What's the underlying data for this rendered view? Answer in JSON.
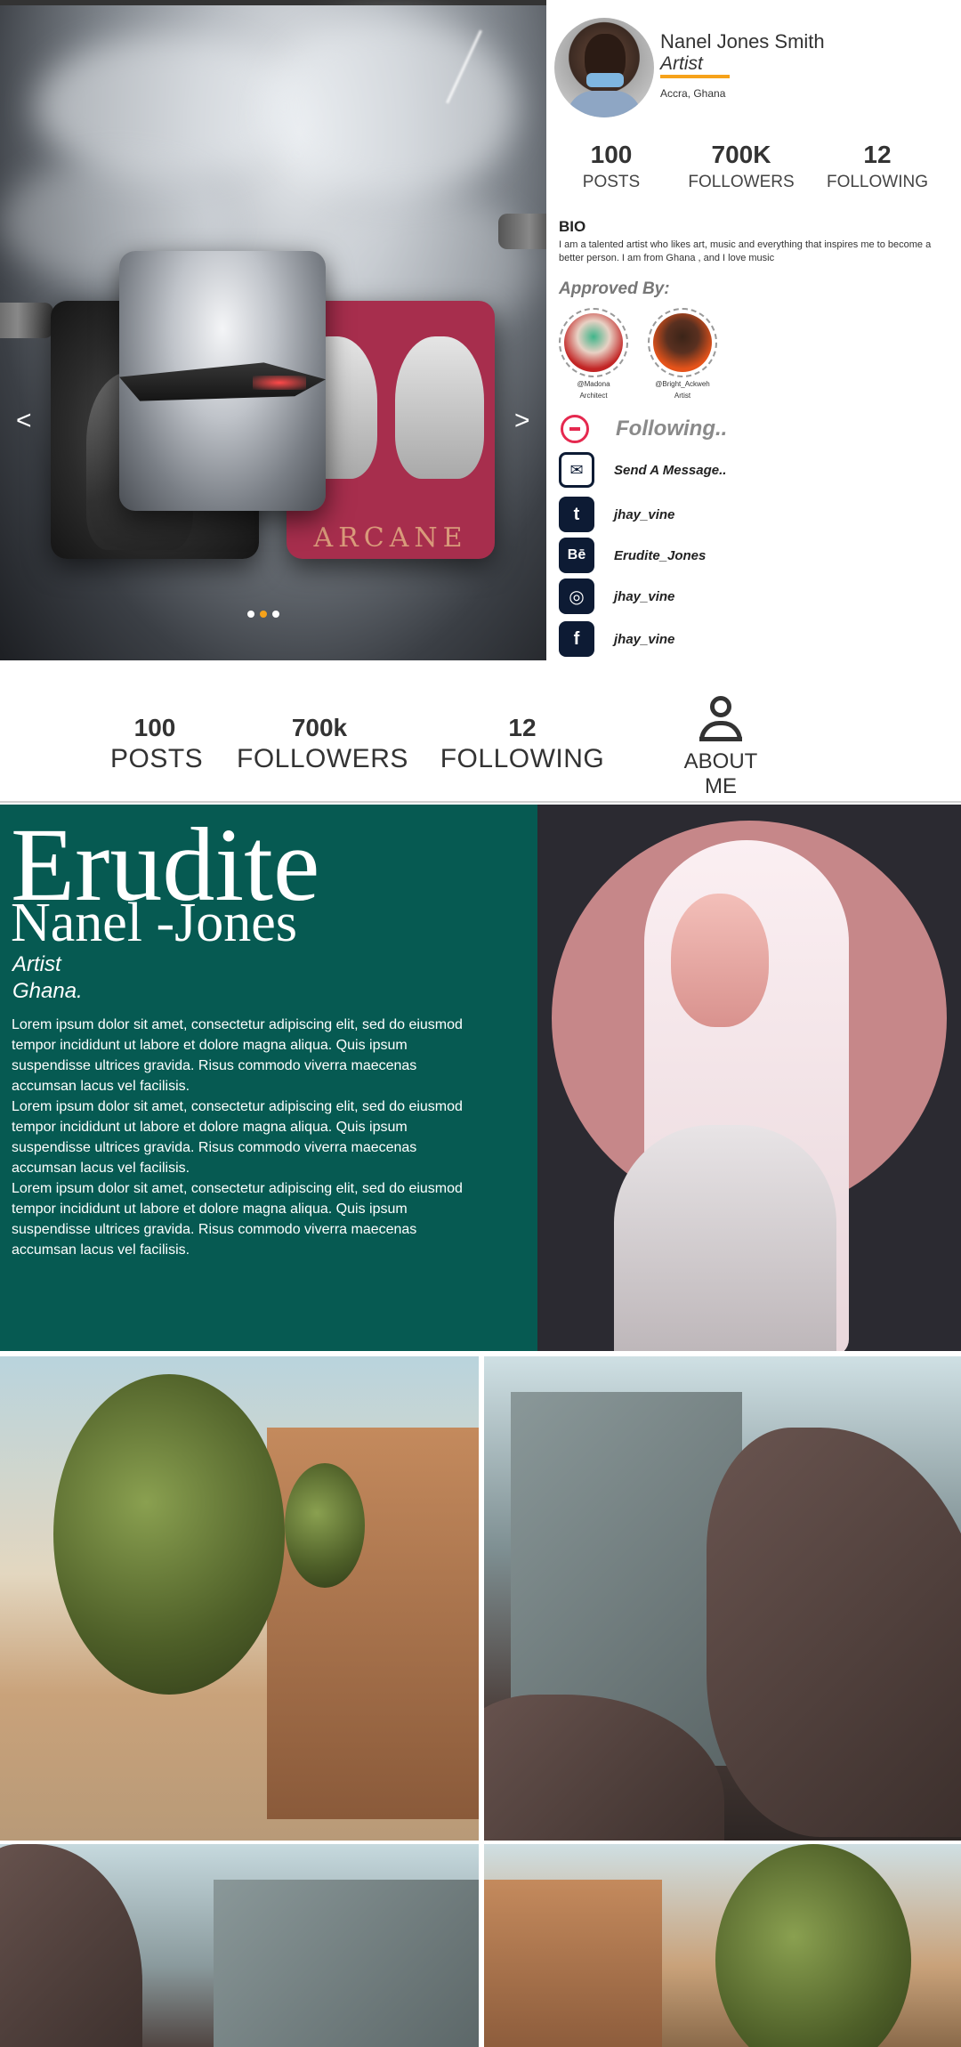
{
  "hero": {
    "card_red_text": "ARCANE",
    "prev_arrow": "<",
    "next_arrow": ">",
    "dots": [
      false,
      true,
      false
    ]
  },
  "profile": {
    "name": "Nanel Jones Smith",
    "role": "Artist",
    "location": "Accra, Ghana",
    "stats": [
      {
        "value": "100",
        "label": "POSTS"
      },
      {
        "value": "700K",
        "label": "FOLLOWERS"
      },
      {
        "value": "12",
        "label": "FOLLOWING"
      }
    ],
    "bio_heading": "BIO",
    "bio_text": "I am a talented artist who likes art, music and everything that inspires me to become a better person. I am from Ghana , and I love music",
    "approved_heading": "Approved By:",
    "approvers": [
      {
        "handle": "@Madona",
        "title": "Architect"
      },
      {
        "handle": "@Bright_Ackweh",
        "title": "Artist"
      }
    ],
    "following_label": "Following..",
    "message_label": "Send A Message..",
    "socials": [
      {
        "icon": "twitter-icon",
        "glyph": "t",
        "handle": "jhay_vine"
      },
      {
        "icon": "behance-icon",
        "glyph": "Bē",
        "handle": "Erudite_Jones"
      },
      {
        "icon": "instagram-icon",
        "glyph": "◎",
        "handle": "jhay_vine"
      },
      {
        "icon": "facebook-icon",
        "glyph": "f",
        "handle": "jhay_vine"
      }
    ]
  },
  "statsbar": {
    "posts": {
      "value": "100",
      "label": "POSTS"
    },
    "followers": {
      "value": "700k",
      "label": "FOLLOWERS"
    },
    "following": {
      "value": "12",
      "label": "FOLLOWING"
    },
    "about_label": "ABOUT ME"
  },
  "about": {
    "title_line1": "Erudite",
    "title_line2": "Nanel -Jones",
    "role": "Artist",
    "location": "Ghana.",
    "paragraphs": [
      "Lorem ipsum dolor sit amet, consectetur adipiscing elit, sed do eiusmod tempor incididunt ut labore et dolore magna aliqua. Quis ipsum suspendisse ultrices gravida. Risus commodo viverra maecenas accumsan lacus vel facilisis.",
      "Lorem ipsum dolor sit amet, consectetur adipiscing elit, sed do eiusmod tempor incididunt ut labore et dolore magna aliqua. Quis ipsum suspendisse ultrices gravida. Risus commodo viverra maecenas accumsan lacus vel facilisis.",
      "Lorem ipsum dolor sit amet, consectetur adipiscing elit, sed do eiusmod tempor incididunt ut labore et dolore magna aliqua. Quis ipsum suspendisse ultrices gravida. Risus commodo viverra maecenas accumsan lacus vel facilisis."
    ]
  },
  "colors": {
    "accent": "#f6a21a",
    "green_panel": "#065a52",
    "icon_navy": "#0d1b34",
    "unfollow_red": "#e5294f"
  }
}
